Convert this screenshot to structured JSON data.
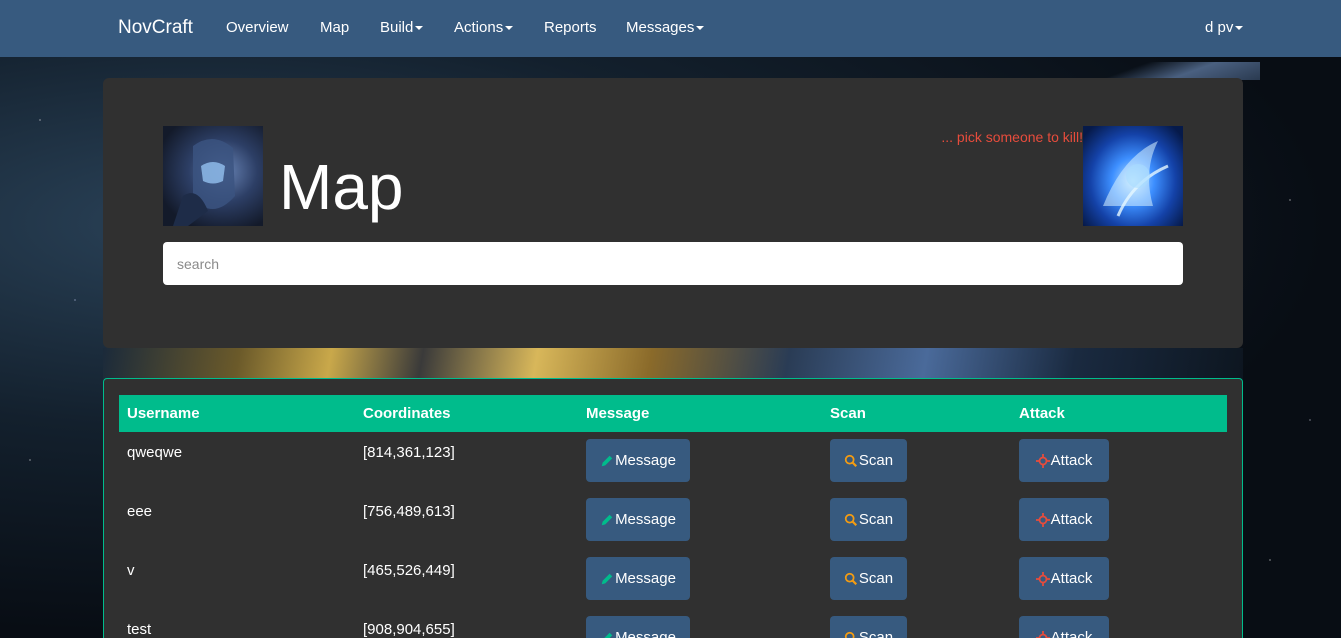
{
  "navbar": {
    "brand": "NovCraft",
    "items": [
      {
        "label": "Overview",
        "dropdown": false
      },
      {
        "label": "Map",
        "dropdown": false
      },
      {
        "label": "Build",
        "dropdown": true
      },
      {
        "label": "Actions",
        "dropdown": true
      },
      {
        "label": "Reports",
        "dropdown": false
      },
      {
        "label": "Messages",
        "dropdown": true
      }
    ],
    "user": "d pv"
  },
  "header": {
    "title": "Map",
    "tagline": "... pick someone to kill!",
    "search_placeholder": "search"
  },
  "table": {
    "columns": [
      "Username",
      "Coordinates",
      "Message",
      "Scan",
      "Attack"
    ],
    "rows": [
      {
        "username": "qweqwe",
        "coordinates": "[814,361,123]"
      },
      {
        "username": "eee",
        "coordinates": "[756,489,613]"
      },
      {
        "username": "v",
        "coordinates": "[465,526,449]"
      },
      {
        "username": "test",
        "coordinates": "[908,904,655]"
      }
    ],
    "actions": {
      "message_label": "Message",
      "scan_label": "Scan",
      "attack_label": "Attack"
    }
  },
  "colors": {
    "navbar": "#375a7f",
    "panel": "#303030",
    "accent": "#00bc8c",
    "tagline": "#e74c3c",
    "pencil_icon": "#00bc8c",
    "search_icon": "#f39c12",
    "crosshair_icon": "#e74c3c"
  },
  "icons": {
    "message": "pencil-icon",
    "scan": "search-icon",
    "attack": "crosshair-icon"
  }
}
